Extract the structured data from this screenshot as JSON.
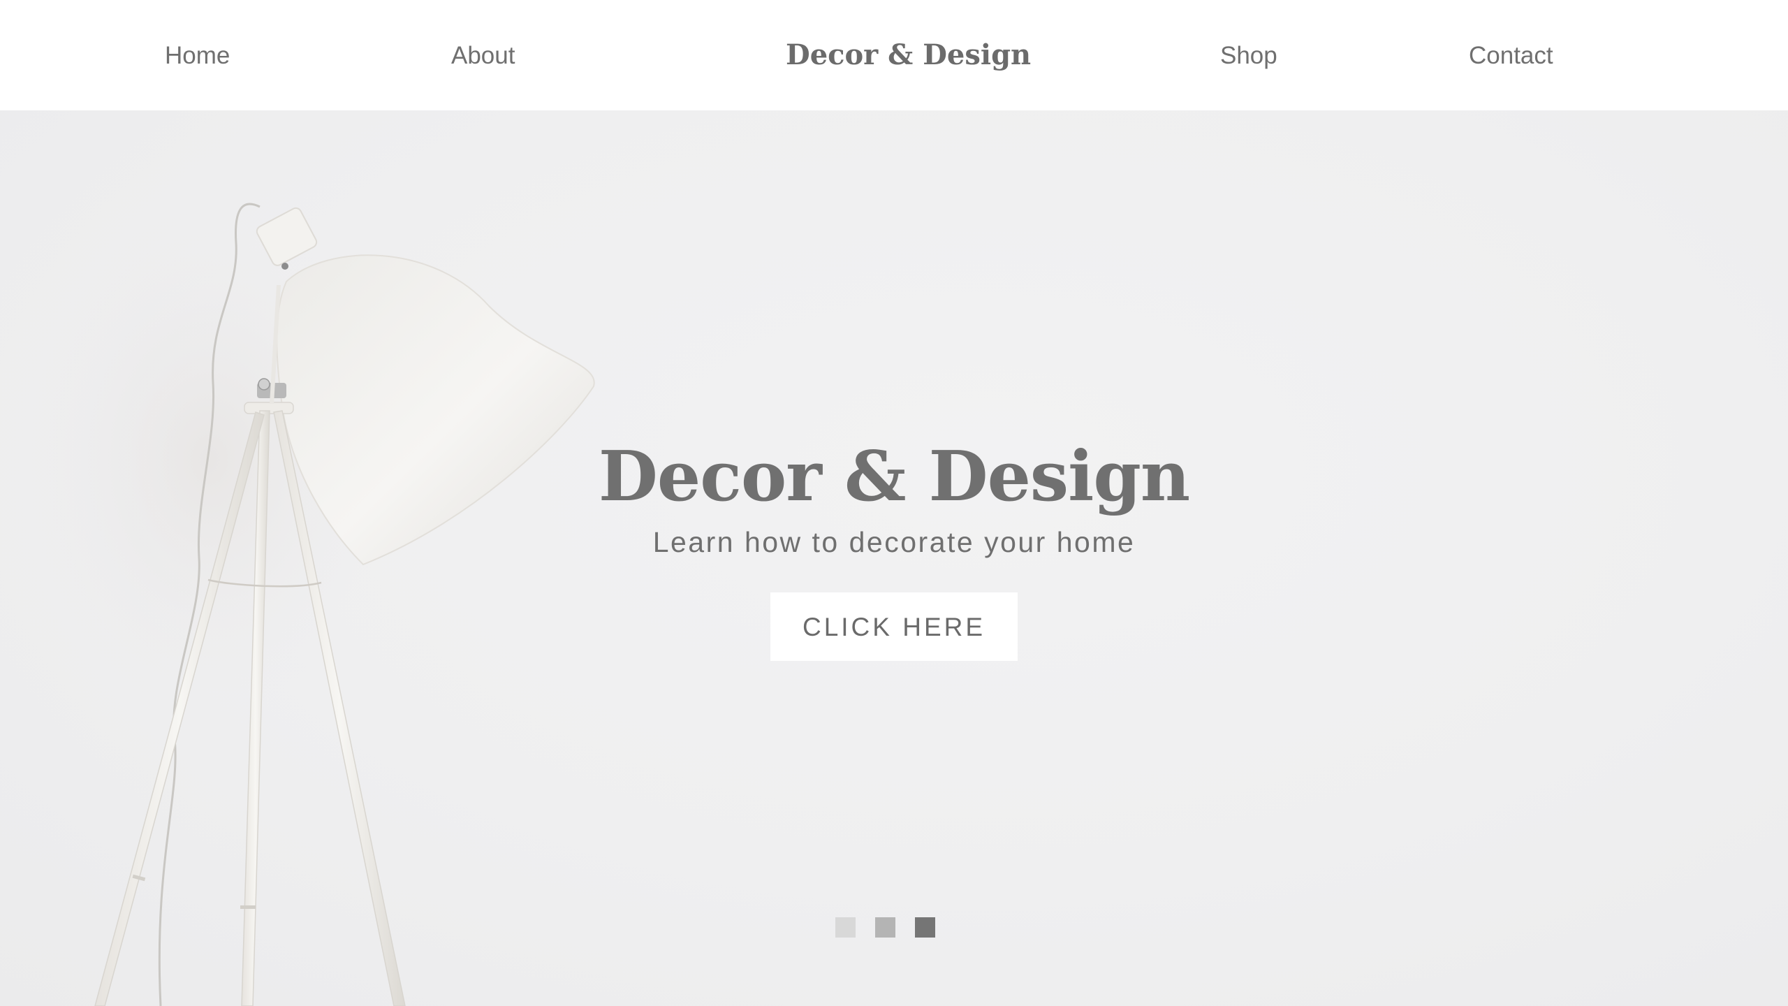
{
  "nav": {
    "items": [
      {
        "label": "Home"
      },
      {
        "label": "About"
      },
      {
        "label": "Shop"
      },
      {
        "label": "Contact"
      }
    ],
    "brand": "Decor & Design"
  },
  "hero": {
    "title": "Decor & Design",
    "subtitle": "Learn how to decorate your home",
    "cta_label": "CLICK HERE",
    "slider": {
      "slide_count": 3,
      "active_slide": 3
    }
  },
  "colors": {
    "text": "#6f6f6f",
    "hero_background": "#efeff0",
    "button_background": "#ffffff",
    "dot_inactive_light": "#d8d8d8",
    "dot_inactive": "#b4b4b4",
    "dot_active": "#757575"
  }
}
